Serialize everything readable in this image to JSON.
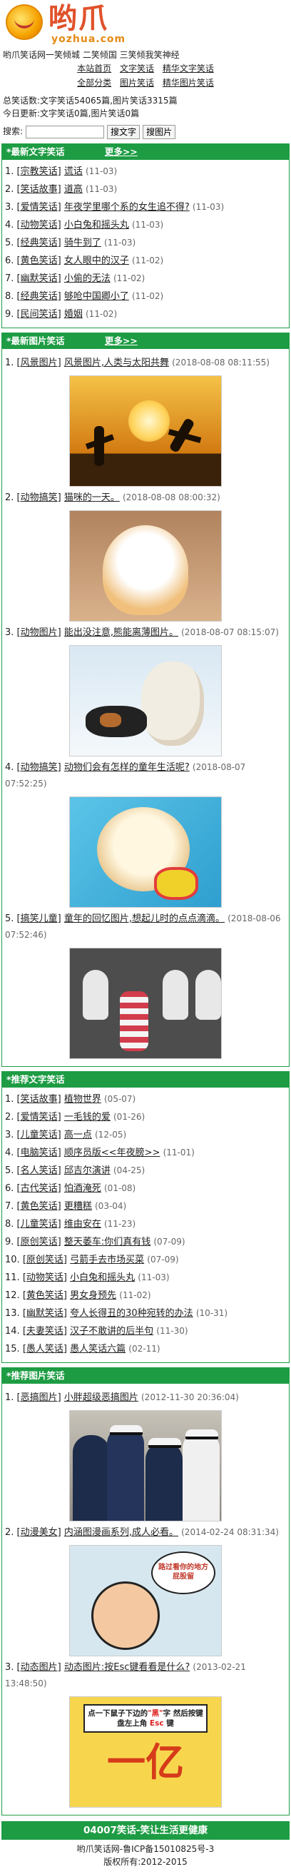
{
  "site": {
    "logo_cn": "哟爪",
    "logo_en": "yozhua.com",
    "tagline": "哟爪笑话网一笑倾城 二笑倾国 三笑倾我笑神经"
  },
  "nav": [
    [
      "本站首页",
      "文字笑话",
      "精华文字笑话"
    ],
    [
      "全部分类",
      "图片笑话",
      "精华图片笑话"
    ]
  ],
  "stats": {
    "total": "总笑话数:文字笑话54065篇,图片笑话3315篇",
    "today": "今日更新:文字笑话0篇,图片笑话0篇"
  },
  "search": {
    "label": "搜索:",
    "placeholder": "",
    "text_button": "搜文字",
    "image_button": "搜图片"
  },
  "latest_text": {
    "title": "*最新文字笑话",
    "more": "更多>>",
    "items": [
      {
        "n": "1.",
        "cat": "[宗教笑话]",
        "title": "谎话",
        "date": "(11-03)"
      },
      {
        "n": "2.",
        "cat": "[笑话故事]",
        "title": "道高",
        "date": "(11-03)"
      },
      {
        "n": "3.",
        "cat": "[爱情笑话]",
        "title": "年夜学里哪个系的女生追不得?",
        "date": "(11-03)"
      },
      {
        "n": "4.",
        "cat": "[动物笑话]",
        "title": "小白兔和摇头丸",
        "date": "(11-03)"
      },
      {
        "n": "5.",
        "cat": "[经典笑话]",
        "title": "骑牛到了",
        "date": "(11-03)"
      },
      {
        "n": "6.",
        "cat": "[黄色笑话]",
        "title": "女人眼中的汉子",
        "date": "(11-02)"
      },
      {
        "n": "7.",
        "cat": "[幽默笑话]",
        "title": "小偷的无法",
        "date": "(11-02)"
      },
      {
        "n": "8.",
        "cat": "[经典笑话]",
        "title": "够呛中国卿小了",
        "date": "(11-02)"
      },
      {
        "n": "9.",
        "cat": "[民间笑话]",
        "title": "婚姻",
        "date": "(11-02)"
      }
    ]
  },
  "latest_pics": {
    "title": "*最新图片笑话",
    "more": "更多>>",
    "items": [
      {
        "n": "1.",
        "cat": "[风景图片]",
        "title": "风景图片,人类与太阳共舞",
        "date": "(2018-08-08 08:11:55)"
      },
      {
        "n": "2.",
        "cat": "[动物搞笑]",
        "title": "猫咪的一天。",
        "date": "(2018-08-08 08:00:32)"
      },
      {
        "n": "3.",
        "cat": "[动物图片]",
        "title": "能出没注意,熊能离薄图片。",
        "date": "(2018-08-07 08:15:07)"
      },
      {
        "n": "4.",
        "cat": "[动物搞笑]",
        "title": "动物们会有怎样的童年生活呢?",
        "date": "(2018-08-07 07:52:25)"
      },
      {
        "n": "5.",
        "cat": "[搞笑儿童]",
        "title": "童年的回忆图片,想起儿时的点点滴滴。",
        "date": "(2018-08-06 07:52:46)"
      }
    ]
  },
  "recommended_text": {
    "title": "*推荐文字笑话",
    "items": [
      {
        "n": "1.",
        "cat": "[笑话故事]",
        "title": "植物世界",
        "date": "(05-07)"
      },
      {
        "n": "2.",
        "cat": "[爱情笑话]",
        "title": "一毛钱的爱",
        "date": "(01-26)"
      },
      {
        "n": "3.",
        "cat": "[儿童笑话]",
        "title": "高一点",
        "date": "(12-05)"
      },
      {
        "n": "4.",
        "cat": "[电脑笑话]",
        "title": "顺序员版<<年夜膀>>",
        "date": "(11-01)"
      },
      {
        "n": "5.",
        "cat": "[名人笑话]",
        "title": "邱吉尔演讲",
        "date": "(04-25)"
      },
      {
        "n": "6.",
        "cat": "[古代笑话]",
        "title": "怕酒淹死",
        "date": "(01-08)"
      },
      {
        "n": "7.",
        "cat": "[黄色笑话]",
        "title": "更糟糕",
        "date": "(03-04)"
      },
      {
        "n": "8.",
        "cat": "[儿童笑话]",
        "title": "维由安在",
        "date": "(11-23)"
      },
      {
        "n": "9.",
        "cat": "[原创笑话]",
        "title": "整天萎车:你们真有钱",
        "date": "(07-09)"
      },
      {
        "n": "10.",
        "cat": "[原创笑话]",
        "title": "弓箭手去市场买菜",
        "date": "(07-09)"
      },
      {
        "n": "11.",
        "cat": "[动物笑话]",
        "title": "小白兔和摇头丸",
        "date": "(11-03)"
      },
      {
        "n": "12.",
        "cat": "[黄色笑话]",
        "title": "男女身预先",
        "date": "(11-02)"
      },
      {
        "n": "13.",
        "cat": "[幽默笑话]",
        "title": "夸人长得丑的30种宛转的办法",
        "date": "(10-31)"
      },
      {
        "n": "14.",
        "cat": "[夫妻笑话]",
        "title": "汉子不敢讲的后半句",
        "date": "(11-30)"
      },
      {
        "n": "15.",
        "cat": "[愚人笑话]",
        "title": "愚人笑话六篇",
        "date": "(02-11)"
      }
    ]
  },
  "recommended_pics": {
    "title": "*推荐图片笑话",
    "items": [
      {
        "n": "1.",
        "cat": "[恶搞图片]",
        "title": "小胖超级恶搞图片",
        "date": "(2012-11-30 20:36:04)"
      },
      {
        "n": "2.",
        "cat": "[动漫美女]",
        "title": "内涵图漫画系列,成人必看。",
        "date": "(2014-02-24 08:31:34)"
      },
      {
        "n": "3.",
        "cat": "[动态图片]",
        "title": "动态图片:按Esc键看看是什么?",
        "date": "(2013-02-21 13:48:50)"
      }
    ]
  },
  "pic_text": {
    "comic_bubble": "路过看你的地方屁股留",
    "esc_note_a": "点一下鼠子下边的",
    "esc_note_red": "\"黑\"",
    "esc_note_b": "字 然后按键盘左上角",
    "esc_key": "Esc",
    "esc_note_c": "键",
    "esc_big": "一亿"
  },
  "footer": {
    "bar": "04007笑话-笑让生活更健康",
    "icp": "哟爪笑话网-鲁ICP备15010825号-3",
    "copyright": "版权所有:2012-2015"
  },
  "colors": {
    "accent": "#1e9c44",
    "logo_red": "#e0522b",
    "logo_orange": "#e58a14"
  }
}
